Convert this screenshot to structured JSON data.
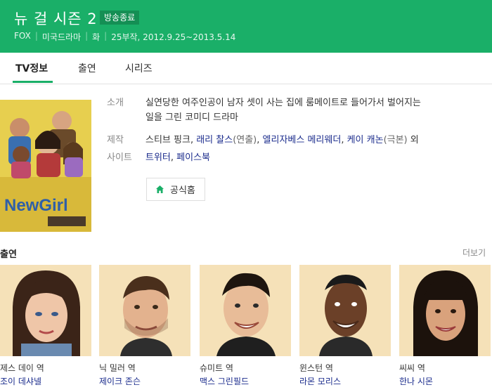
{
  "header": {
    "title": "뉴 걸 시즌 2",
    "badge": "방송종료",
    "meta": [
      "FOX",
      "미국드라마",
      "화",
      "25부작, 2012.9.25~2013.5.14"
    ],
    "colors": {
      "background": "#1aaf68",
      "badge": "#148f54"
    }
  },
  "tabs": [
    {
      "label": "TV정보",
      "active": true
    },
    {
      "label": "출연",
      "active": false
    },
    {
      "label": "시리즈",
      "active": false
    }
  ],
  "poster": {
    "logo_text": "NewGirl",
    "alt_icon": "tv-show-poster"
  },
  "info": {
    "intro_label": "소개",
    "intro_line1": "실연당한 여주인공이 남자 셋이 사는 집에 룸메이트로 들어가서 벌어지는",
    "intro_line2": "일을 그린 코미디 드라마",
    "production_label": "제작",
    "production": {
      "p1": "스티브 핑크",
      "sep1": ", ",
      "p2": "래리 찰스",
      "p2_role": "(연출)",
      "sep2": ", ",
      "p3": "엘리자베스 메리웨더",
      "sep3": ", ",
      "p4": "케이 캐논",
      "p4_role": "(극본)",
      "suffix": " 외"
    },
    "site_label": "사이트",
    "sites": {
      "s1": "트위터",
      "sep": ", ",
      "s2": "페이스북"
    },
    "homepage_button": "공식홈"
  },
  "cast_section": {
    "title": "출연",
    "more": "더보기",
    "members": [
      {
        "role": "제스 데이 역",
        "name": "조이 데샤넬"
      },
      {
        "role": "닉 밀러 역",
        "name": "제이크 존슨"
      },
      {
        "role": "슈미트 역",
        "name": "맥스 그린필드"
      },
      {
        "role": "윈스턴 역",
        "name": "라몬 모리스"
      },
      {
        "role": "씨씨 역",
        "name": "한나 시몬"
      }
    ]
  },
  "colors": {
    "accent": "#1aaf68",
    "link": "#1a2b8c"
  }
}
